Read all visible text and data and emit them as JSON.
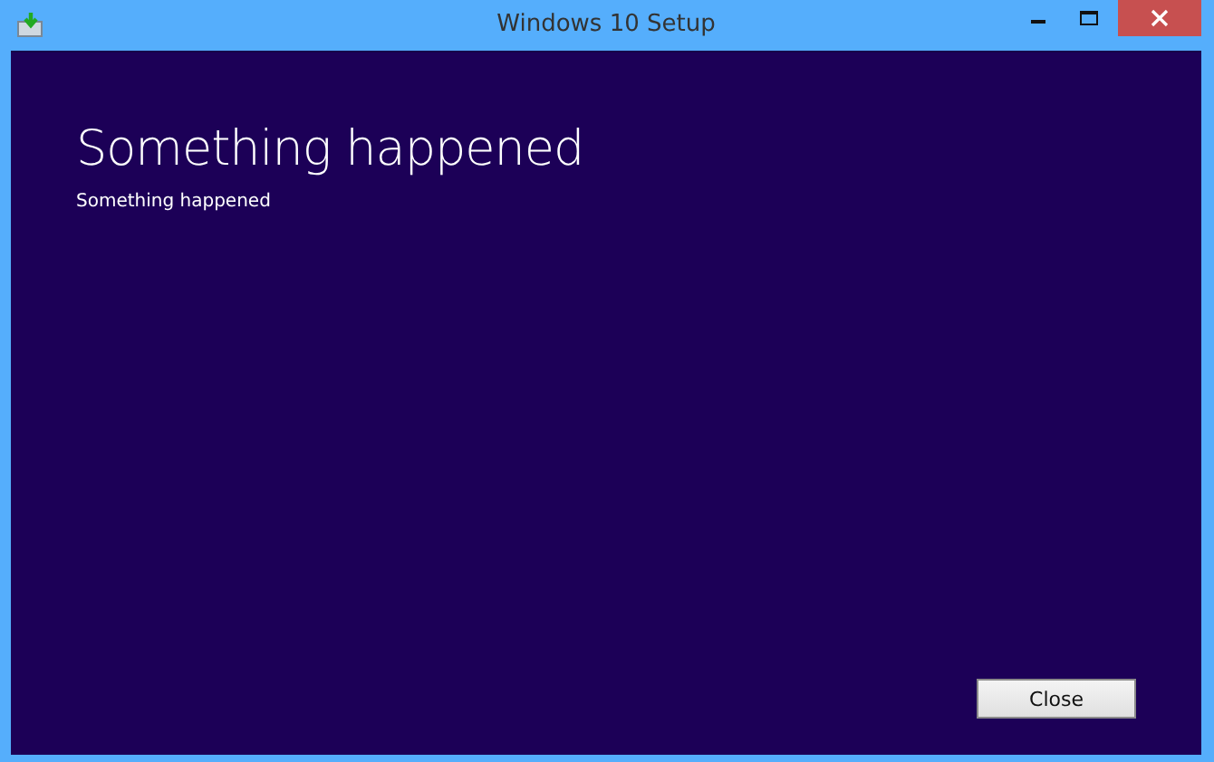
{
  "window": {
    "title": "Windows 10 Setup"
  },
  "heading": "Something happened",
  "message": "Something happened",
  "buttons": [
    "Close"
  ]
}
